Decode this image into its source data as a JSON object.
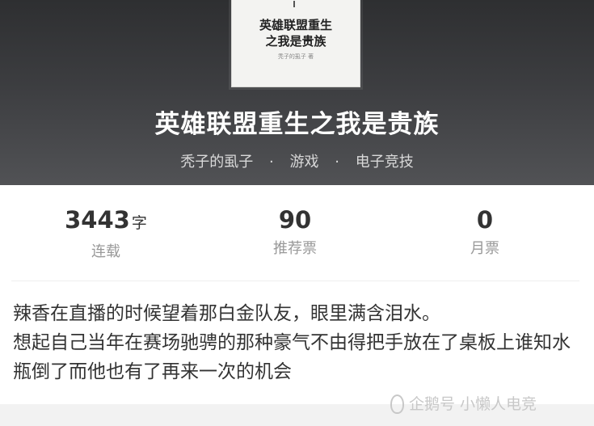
{
  "cover": {
    "title": "英雄联盟重生\n之我是贵族",
    "author_line": "秃子的虱子 著"
  },
  "book": {
    "title": "英雄联盟重生之我是贵族",
    "author": "秃子的虱子",
    "category": "游戏",
    "subcategory": "电子竞技",
    "separator": "·"
  },
  "stats": {
    "words": {
      "value": "3443",
      "unit": "字",
      "label": "连载"
    },
    "recommend": {
      "value": "90",
      "label": "推荐票"
    },
    "monthly": {
      "value": "0",
      "label": "月票"
    }
  },
  "content": {
    "line1": "辣香在直播的时候望着那白金队友，眼里满含泪水。",
    "line2": "想起自己当年在赛场驰骋的那种豪气不由得把手放在了桌板上谁知水瓶倒了而他也有了再来一次的机会"
  },
  "watermark": {
    "text": "企鹅号 小懒人电竞",
    "icon": "penguin-icon"
  }
}
